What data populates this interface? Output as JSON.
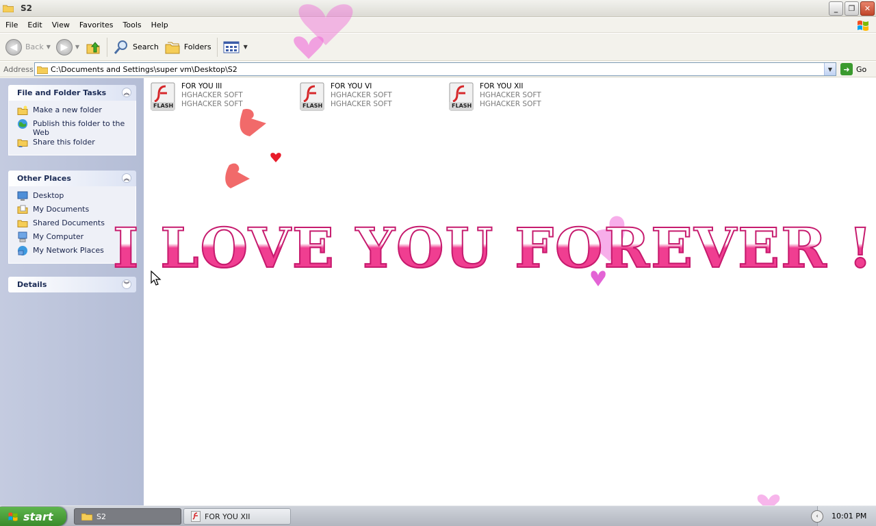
{
  "window": {
    "title": "S2",
    "buttons": {
      "minimize": "_",
      "restore": "❐",
      "close": "✕"
    }
  },
  "menu": [
    "File",
    "Edit",
    "View",
    "Favorites",
    "Tools",
    "Help"
  ],
  "toolbar": {
    "back_label": "Back",
    "search_label": "Search",
    "folders_label": "Folders"
  },
  "address": {
    "label": "Address",
    "path": "C:\\Documents and Settings\\super vm\\Desktop\\S2",
    "go_label": "Go"
  },
  "left_pane": {
    "tasks": {
      "title": "File and Folder Tasks",
      "items": [
        "Make a new folder",
        "Publish this folder to the Web",
        "Share this folder"
      ]
    },
    "other_places": {
      "title": "Other Places",
      "items": [
        "Desktop",
        "My Documents",
        "Shared Documents",
        "My Computer",
        "My Network Places"
      ]
    },
    "details": {
      "title": "Details"
    }
  },
  "files": [
    {
      "name": "FOR YOU III",
      "line2": "HGHACKER SOFT",
      "line3": "HGHACKER SOFT",
      "badge": "FLASH"
    },
    {
      "name": "FOR YOU VI",
      "line2": "HGHACKER SOFT",
      "line3": "HGHACKER SOFT",
      "badge": "FLASH"
    },
    {
      "name": "FOR YOU XII",
      "line2": "HGHACKER SOFT",
      "line3": "HGHACKER SOFT",
      "badge": "FLASH"
    }
  ],
  "overlay_text": "I LOVE YOU FOREVER !",
  "taskbar": {
    "start_label": "start",
    "tasks": [
      "S2",
      "FOR YOU XII"
    ],
    "clock": "10:01 PM"
  },
  "colors": {
    "overlay_pink": "#f0388e",
    "heart_red": "#f05a5a",
    "heart_pink": "#f06bd8"
  }
}
